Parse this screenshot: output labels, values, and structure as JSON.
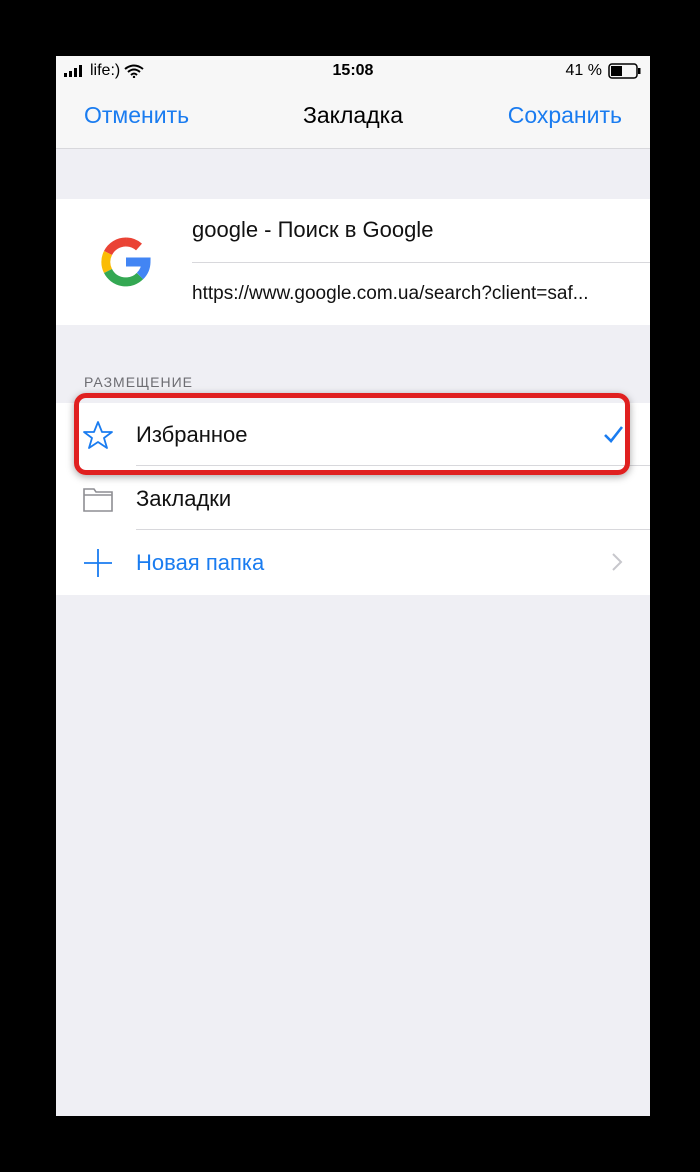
{
  "status_bar": {
    "carrier": "life:)",
    "time": "15:08",
    "battery_percent": "41 %",
    "icons": [
      "signal-icon",
      "wifi-icon",
      "battery-icon"
    ]
  },
  "nav": {
    "cancel_label": "Отменить",
    "title": "Закладка",
    "save_label": "Сохранить"
  },
  "bookmark": {
    "title": "google - Поиск в Google",
    "url": "https://www.google.com.ua/search?client=saf...",
    "icon": "google-logo"
  },
  "location": {
    "header": "РАЗМЕЩЕНИЕ",
    "items": [
      {
        "label": "Избранное",
        "icon": "star-icon",
        "selected": true
      },
      {
        "label": "Закладки",
        "icon": "folder-icon",
        "selected": false
      },
      {
        "label": "Новая папка",
        "icon": "plus-icon",
        "selected": false
      }
    ]
  },
  "colors": {
    "accent": "#1a7cf0",
    "highlight": "#e02020",
    "background": "#efeff4"
  }
}
